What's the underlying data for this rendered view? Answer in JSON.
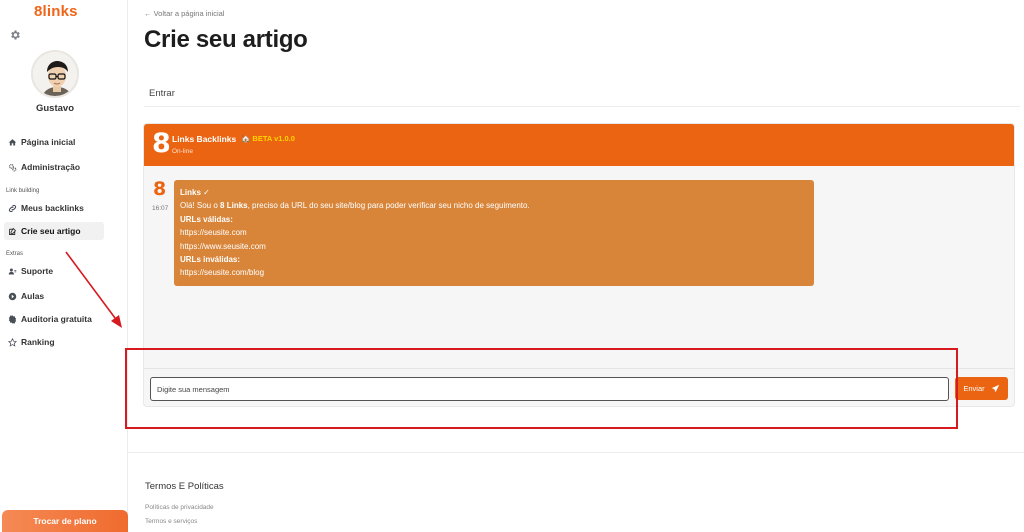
{
  "app": {
    "logo": "8links"
  },
  "user": {
    "name": "Gustavo"
  },
  "sidebar": {
    "items": [
      {
        "label": "Página inicial",
        "icon": "home-icon"
      },
      {
        "label": "Administração",
        "icon": "gears-icon"
      }
    ],
    "section_link_building": "Link building",
    "link_items": [
      {
        "label": "Meus backlinks",
        "icon": "link-icon"
      },
      {
        "label": "Crie seu artigo",
        "icon": "edit-icon",
        "active": true
      }
    ],
    "section_extras": "Extras",
    "extra_items": [
      {
        "label": "Suporte",
        "icon": "user-support-icon"
      },
      {
        "label": "Aulas",
        "icon": "play-circle-icon"
      },
      {
        "label": "Auditoria gratuita",
        "icon": "badge-icon"
      },
      {
        "label": "Ranking",
        "icon": "star-icon"
      }
    ],
    "plan_button": "Trocar de plano"
  },
  "main": {
    "back_link": "← Voltar a página inicial",
    "title": "Crie seu artigo",
    "tab": "Entrar"
  },
  "chat": {
    "header": {
      "logo_digit": "8",
      "bot_name": "Links Backlinks",
      "beta": "🏠 BETA v1.0.0",
      "status": "On-line"
    },
    "message": {
      "avatar_digit": "8",
      "time": "16:07",
      "sender": "Links ✓",
      "intro_before": "Olá! Sou o ",
      "intro_brand": "8 Links",
      "intro_after": ", preciso da URL do seu site/blog para poder verificar seu nicho de seguimento.",
      "valid_heading": "URLs válidas:",
      "valid_urls": [
        "https://seusite.com",
        "https://www.seusite.com"
      ],
      "invalid_heading": "URLs inválidas:",
      "invalid_urls": [
        "https://seusite.com/blog"
      ]
    },
    "input_placeholder": "Digite sua mensagem",
    "send_label": "Enviar"
  },
  "footer": {
    "title": "Termos E Políticas",
    "links": [
      "Políticas de privacidade",
      "Termos e serviços"
    ]
  },
  "colors": {
    "brand": "#eb6411",
    "bubble": "#d8853a",
    "beta": "#ffd400",
    "annotation": "#d71920"
  }
}
